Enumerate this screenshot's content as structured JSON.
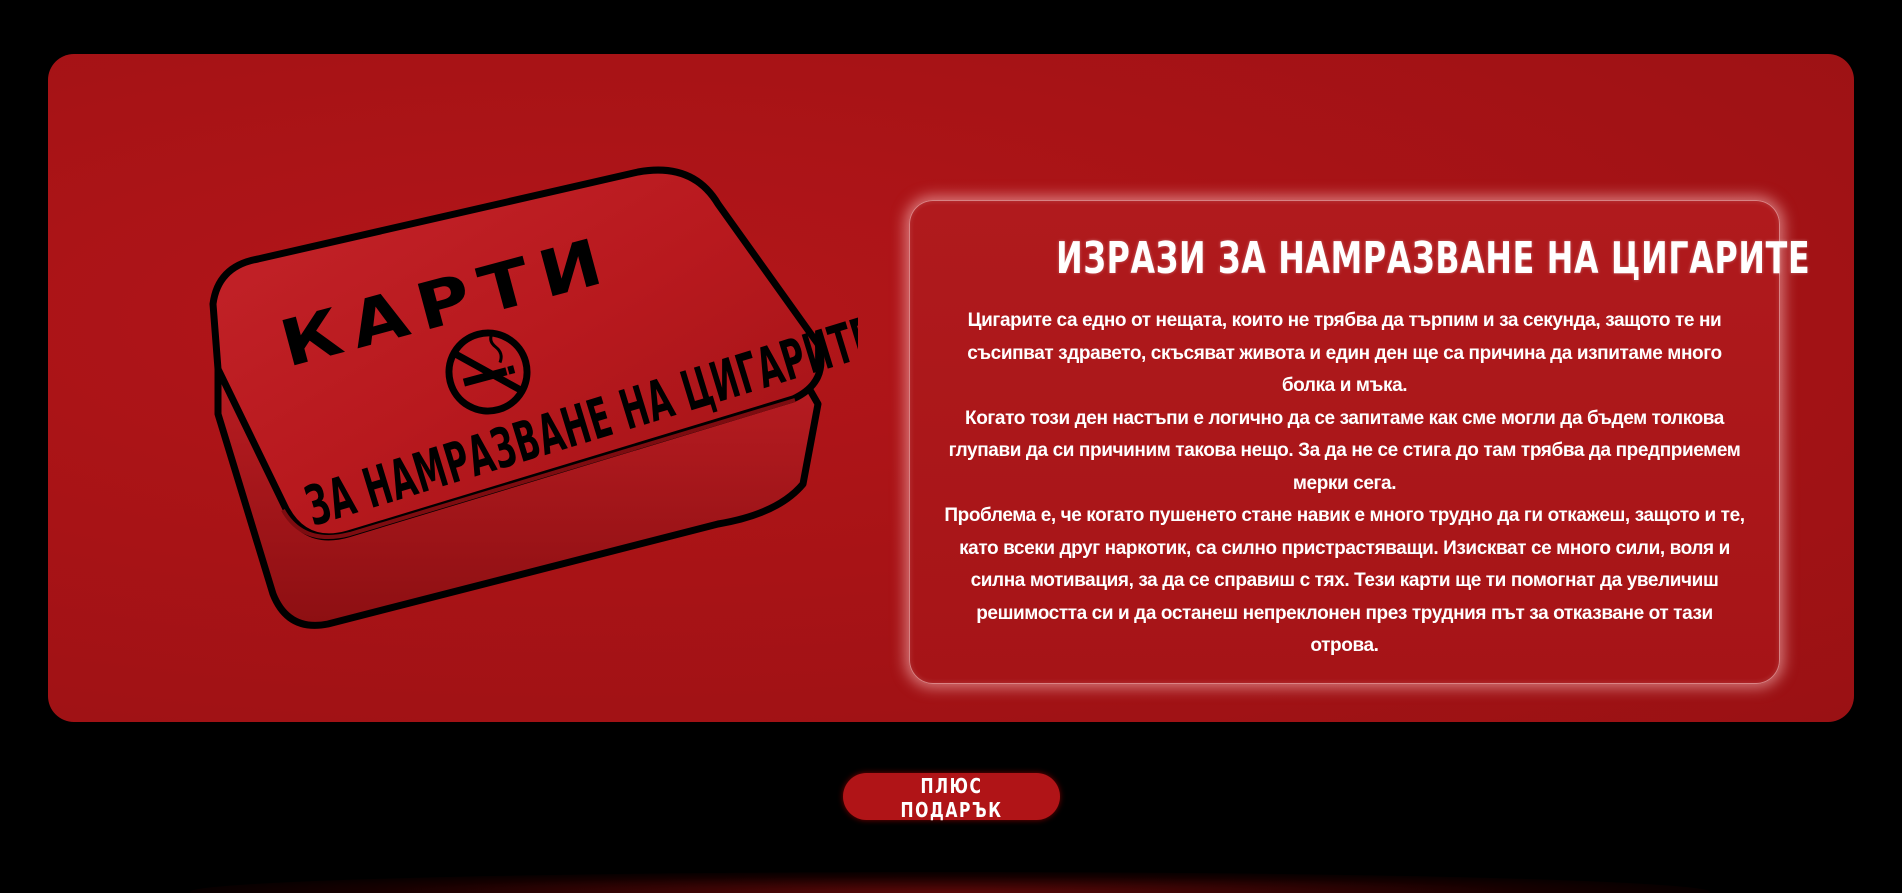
{
  "hero": {
    "product": {
      "lid_top_text": "КАРТИ",
      "lid_bottom_text": "ЗА НАМРАЗВАНЕ НА ЦИГАРИТЕ",
      "icon": "no-smoking-icon"
    },
    "card": {
      "title": "ИЗРАЗИ ЗА НАМРАЗВАНЕ НА ЦИГАРИТЕ",
      "paragraphs": [
        "Цигарите са едно от нещата, които не трябва да търпим и за секунда, защото те ни съсипват здравето, скъсяват живота и един ден ще са причина да изпитаме много болка и мъка.",
        "Когато този ден настъпи е логично да се запитаме как сме могли да бъдем толкова глупави да си причиним такова нещо. За да не се стига до там трябва да предприемем мерки сега.",
        "Проблема е, че когато пушенето стане навик е много трудно да ги откажеш, защото и те, като всеки друг наркотик, са силно пристрастяващи. Изискват се много сили, воля и силна мотивация, за да се справиш с тях. Тези карти ще ти помогнат да увеличиш решимостта си и да останеш непреклонен през трудния път за отказване от тази отрова."
      ]
    }
  },
  "cta": {
    "label": "ПЛЮС ПОДАРЪК"
  },
  "colors": {
    "background": "#000000",
    "hero": "#a81316",
    "button": "#b01417",
    "text": "#ffffff"
  }
}
